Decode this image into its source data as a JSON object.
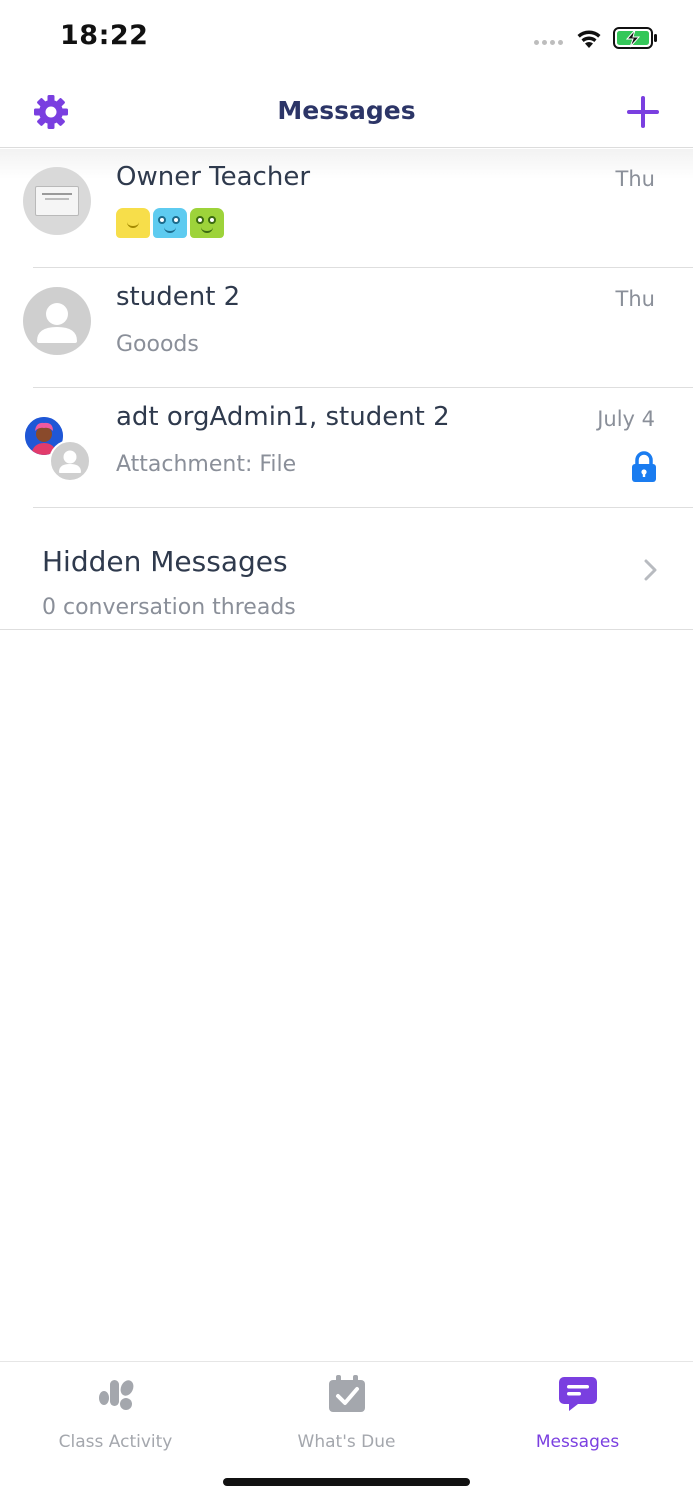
{
  "status_bar": {
    "time": "18:22"
  },
  "header": {
    "title": "Messages",
    "accent_color": "#7a3fe0",
    "title_color": "#2c3567"
  },
  "conversations": [
    {
      "name": "Owner Teacher",
      "date": "Thu",
      "preview": "",
      "preview_type": "monster-stickers"
    },
    {
      "name": "student 2",
      "date": "Thu",
      "preview": "Gooods"
    },
    {
      "name": "adt orgAdmin1, student 2",
      "date": "July 4",
      "preview": "Attachment: File",
      "locked": true
    }
  ],
  "hidden_messages": {
    "title": "Hidden Messages",
    "subtitle": "0 conversation threads"
  },
  "tabs": [
    {
      "label": "Class Activity",
      "icon": "class-activity-icon",
      "active": false
    },
    {
      "label": "What's Due",
      "icon": "whats-due-icon",
      "active": false
    },
    {
      "label": "Messages",
      "icon": "messages-icon",
      "active": true
    }
  ],
  "colors": {
    "lock": "#1a7cf0",
    "inactive_tab": "#a4a7ad",
    "active_tab": "#7a3fe0"
  }
}
